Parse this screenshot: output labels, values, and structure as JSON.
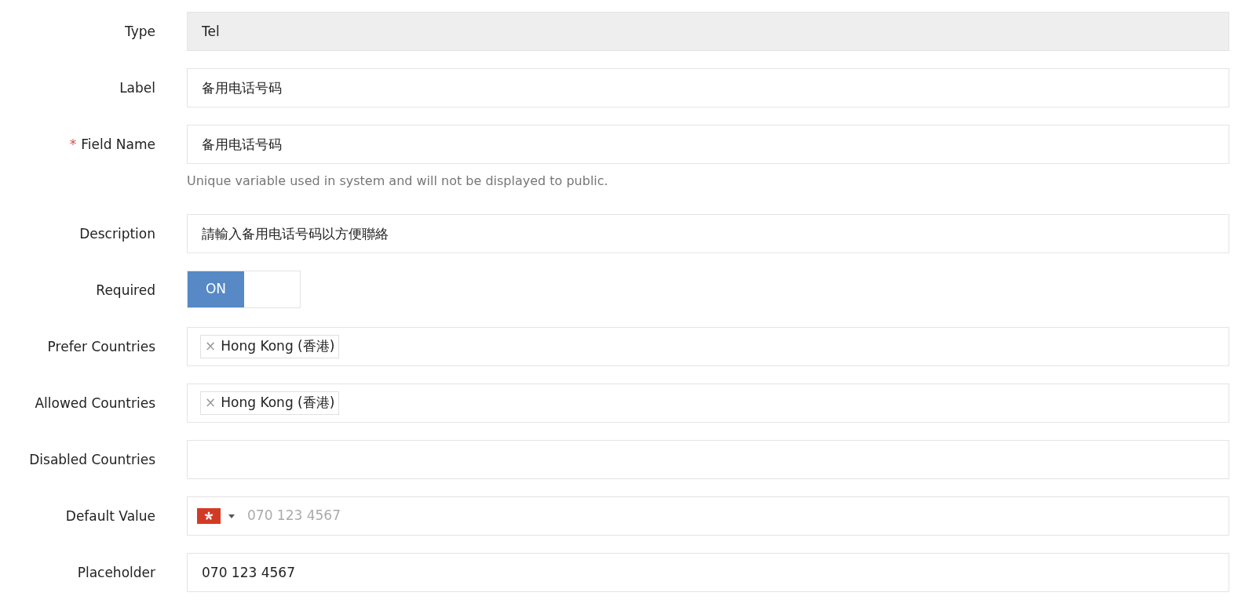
{
  "fields": [
    {
      "kind": "readonly",
      "label": "Type",
      "value": "Tel"
    },
    {
      "kind": "text",
      "label": "Label",
      "value": "备用电话号码"
    },
    {
      "kind": "text",
      "label": "Field Name",
      "required_mark": "*",
      "value": "备用电话号码",
      "help": "Unique variable used in system and will not be displayed to public."
    },
    {
      "kind": "text",
      "label": "Description",
      "value": "請輸入备用电话号码以方便聯絡"
    },
    {
      "kind": "toggle",
      "label": "Required",
      "on": true,
      "state_label": "ON"
    },
    {
      "kind": "tags",
      "label": "Prefer Countries",
      "tags": [
        {
          "remove": "×",
          "text": "Hong Kong (香港)"
        }
      ]
    },
    {
      "kind": "tags",
      "label": "Allowed Countries",
      "tags": [
        {
          "remove": "×",
          "text": "Hong Kong (香港)"
        }
      ]
    },
    {
      "kind": "tags",
      "label": "Disabled Countries"
    },
    {
      "kind": "phone",
      "label": "Default Value",
      "placeholder": "070 123 4567"
    },
    {
      "kind": "text",
      "label": "Placeholder",
      "value": "070 123 4567"
    }
  ]
}
